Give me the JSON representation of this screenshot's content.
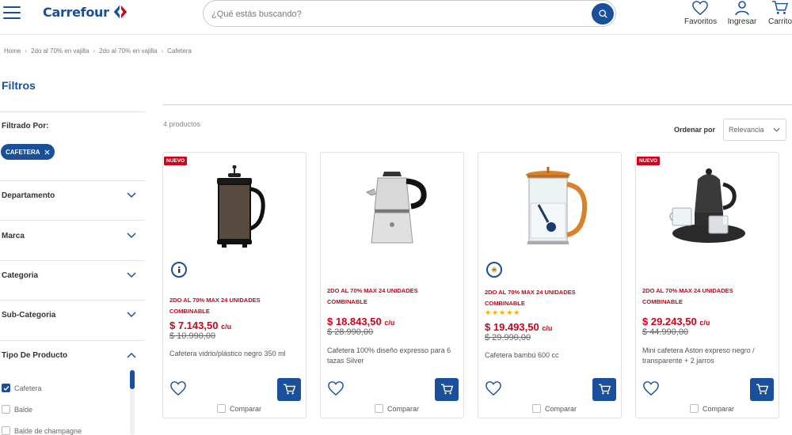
{
  "header": {
    "logo_text": "Carrefour",
    "search_placeholder": "¿Qué estás buscando?",
    "favoritos_label": "Favoritos",
    "ingresar_label": "Ingresar",
    "carrito_label": "Carrito"
  },
  "breadcrumb": [
    "Home",
    "2do al 70% en vajilla",
    "2do al 70% en vajilla",
    "Cafetera"
  ],
  "sidebar": {
    "title": "Filtros",
    "filtered_by_label": "Filtrado Por:",
    "active_chip": "CAFETERA",
    "facets": [
      "Departamento",
      "Marca",
      "Categoria",
      "Sub-Categoria",
      "Tipo De Producto"
    ],
    "tipo_options": [
      {
        "label": "Cafetera",
        "checked": true
      },
      {
        "label": "Balde",
        "checked": false
      },
      {
        "label": "Balde de champagne",
        "checked": false
      }
    ]
  },
  "results": {
    "count_text": "4 productos",
    "sort_label": "Ordenar por",
    "sort_value": "Relevancia"
  },
  "products": [
    {
      "badge": "NUEVO",
      "promo": "2DO AL 70% MAX 24 UNIDADES COMBINABLE",
      "price": "$ 7.143,50",
      "unit": "c/u",
      "old_price": "$ 10.990,00",
      "name": "Cafetera vidrio/plástico negro 350 ml",
      "compare_label": "Comparar",
      "has_promo_icon": true,
      "rating": 0
    },
    {
      "badge": "",
      "promo": "2DO AL 70% MAX 24 UNIDADES COMBINABLE",
      "price": "$ 18.843,50",
      "unit": "c/u",
      "old_price": "$ 28.990,00",
      "name": "Cafetera 100% diseño expresso para 6 tazas Silver",
      "compare_label": "Comparar",
      "has_promo_icon": false,
      "rating": 0
    },
    {
      "badge": "",
      "promo": "2DO AL 70% MAX 24 UNIDADES COMBINABLE",
      "price": "$ 19.493,50",
      "unit": "c/u",
      "old_price": "$ 29.990,00",
      "name": "Cafetera bambú 600 cc",
      "compare_label": "Comparar",
      "has_promo_icon": true,
      "rating": 5
    },
    {
      "badge": "NUEVO",
      "promo": "2DO AL 70% MAX 24 UNIDADES COMBINABLE",
      "price": "$ 29.243,50",
      "unit": "c/u",
      "old_price": "$ 44.990,00",
      "name": "Mini cafetera Aston expreso negro / transparente + 2 jarros",
      "compare_label": "Comparar",
      "has_promo_icon": false,
      "rating": 0
    }
  ],
  "colors": {
    "brand_blue": "#1a4f9c",
    "promo_red": "#d0021b",
    "star_yellow": "#f0b400"
  },
  "icons": [
    "menu-icon",
    "search-icon",
    "heart-icon",
    "user-icon",
    "cart-icon",
    "chevron-down-icon",
    "chevron-up-icon",
    "close-icon",
    "check-icon"
  ]
}
